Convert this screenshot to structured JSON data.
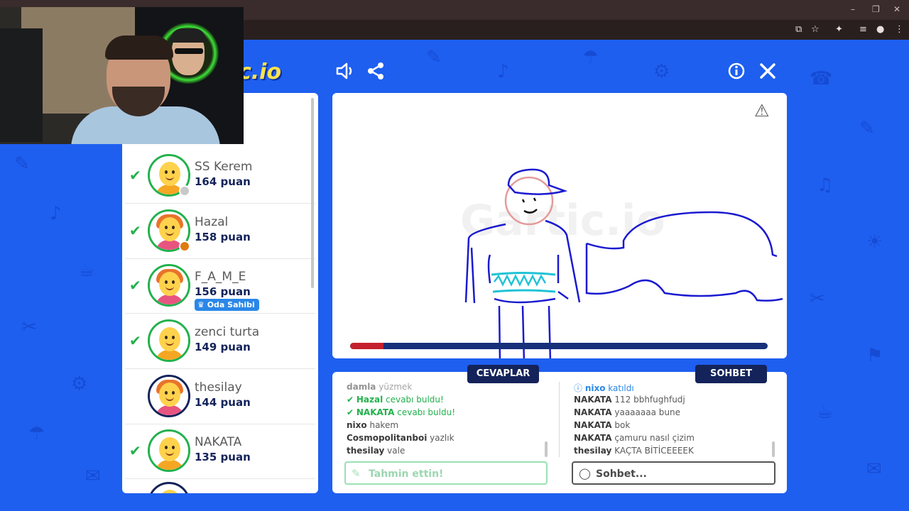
{
  "browser": {
    "minimize": "–",
    "restore": "❐",
    "close": "✕",
    "icons": [
      "cast-icon",
      "star-icon",
      "extensions-icon",
      "media-icon",
      "profile-icon",
      "menu-icon"
    ]
  },
  "game": {
    "logo_text": "c.io",
    "toolbar": {
      "sound_icon": "speaker-icon",
      "share_icon": "share-icon",
      "info_icon": "info-icon",
      "close_icon": "close-icon"
    },
    "canvas": {
      "progress": 0.08,
      "progress_color": "#c4202e",
      "watermark": "Gartic.io"
    }
  },
  "players": [
    {
      "name": "SS Kerem",
      "points": "164 puan",
      "guessed": true,
      "hair": "none",
      "dot_color": "#c8c8c8",
      "badge": ""
    },
    {
      "name": "Hazal",
      "points": "158 puan",
      "guessed": true,
      "hair": "#e8742a",
      "dot_color": "#e07b10",
      "badge": ""
    },
    {
      "name": "F_A_M_E",
      "points": "156 puan",
      "guessed": true,
      "hair": "#e8742a",
      "dot_color": "",
      "badge": "Oda Sahibi"
    },
    {
      "name": "zenci turta",
      "points": "149 puan",
      "guessed": true,
      "hair": "none",
      "dot_color": "",
      "badge": ""
    },
    {
      "name": "thesilay",
      "points": "144 puan",
      "guessed": false,
      "hair": "#e8742a",
      "dot_color": "",
      "badge": ""
    },
    {
      "name": "NAKATA",
      "points": "135 puan",
      "guessed": true,
      "hair": "none",
      "dot_color": "",
      "badge": ""
    }
  ],
  "tabs": {
    "answers": "CEVAPLAR",
    "chat": "SOHBET"
  },
  "answers_log": [
    {
      "user": "damla",
      "text": "yüzmek",
      "type": "faded"
    },
    {
      "user": "Hazal",
      "text": "cevabı buldu!",
      "type": "found"
    },
    {
      "user": "NAKATA",
      "text": "cevabı buldu!",
      "type": "found"
    },
    {
      "user": "nixo",
      "text": "hakem",
      "type": "normal"
    },
    {
      "user": "Cosmopolitanboi",
      "text": "yazlık",
      "type": "normal"
    },
    {
      "user": "thesilay",
      "text": "vale",
      "type": "normal"
    }
  ],
  "chat_log": [
    {
      "user": "nixo",
      "text": "katıldı",
      "type": "joined"
    },
    {
      "user": "NAKATA",
      "text": "112 bbhfughfudj",
      "type": "normal"
    },
    {
      "user": "NAKATA",
      "text": "yaaaaaaa bune",
      "type": "normal"
    },
    {
      "user": "NAKATA",
      "text": "bok",
      "type": "normal"
    },
    {
      "user": "NAKATA",
      "text": "çamuru nasıl çizim",
      "type": "normal"
    },
    {
      "user": "thesilay",
      "text": "KAÇTA BİTİCEEEEK",
      "type": "normal"
    }
  ],
  "inputs": {
    "guess_placeholder": "Tahmin ettin!",
    "chat_placeholder": "Sohbet..."
  }
}
